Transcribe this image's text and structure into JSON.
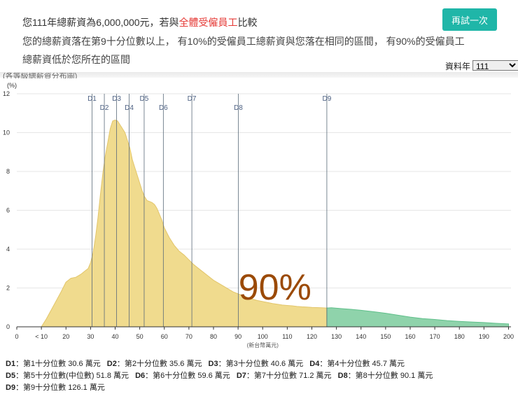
{
  "header": {
    "line1_prefix": "您111年總薪資為6,000,000元，若與",
    "line1_highlight": "全體受僱員工",
    "line1_suffix": "比較",
    "line2": "您的總薪資落在第9十分位數以上， 有10%的受僱員工總薪資與您落在相同的區間， 有90%的受僱員工",
    "line3": "總薪資低於您所在的區間",
    "retry_label": "再試一次",
    "year_label": "資料年",
    "year_value": "111",
    "cutoff_text": "(各等級總薪資分布圖)"
  },
  "chart_data": {
    "type": "area",
    "ylabel": "(%)",
    "xlabel": "(新台幣萬元)",
    "xlim": [
      0,
      201
    ],
    "ylim": [
      0,
      12
    ],
    "x_ticks": [
      0,
      10,
      20,
      30,
      40,
      50,
      60,
      70,
      80,
      90,
      100,
      110,
      120,
      130,
      140,
      150,
      160,
      170,
      180,
      190,
      200
    ],
    "x_tick_labels": [
      "0",
      "< 10",
      "20",
      "30",
      "40",
      "50",
      "60",
      "70",
      "80",
      "90",
      "100",
      "110",
      "120",
      "130",
      "140",
      "150",
      "160",
      "170",
      "180",
      "190",
      "200"
    ],
    "y_ticks": [
      0,
      2,
      4,
      6,
      8,
      10,
      12
    ],
    "colors": {
      "below": "#f0db8e",
      "below_stroke": "#e2c56a",
      "above": "#8fd3ab",
      "above_stroke": "#5fbf8a",
      "decile_line": "#5a6a7a",
      "decile_label": "#4a5e80",
      "percent_text": "#9b4a06"
    },
    "series": [
      {
        "x": [
          10,
          12,
          15,
          18,
          20,
          22,
          24,
          26,
          28,
          29,
          30,
          31,
          32,
          33,
          34,
          35,
          36,
          37,
          38,
          39,
          40,
          41,
          42,
          43,
          44,
          45,
          46,
          47,
          48,
          49,
          50,
          51,
          52,
          53,
          54,
          55,
          56,
          57,
          58,
          59,
          60,
          62,
          64,
          66,
          68,
          70,
          72,
          74,
          76,
          78,
          80,
          82,
          84,
          86,
          88,
          90,
          92,
          94,
          96,
          98,
          100,
          102,
          104,
          106,
          108,
          110,
          112,
          114,
          116,
          118,
          120,
          122,
          124,
          126,
          128,
          130,
          133,
          136,
          140,
          145,
          150,
          155,
          160,
          165,
          170,
          175,
          180,
          185,
          190,
          195,
          200
        ],
        "values": [
          0,
          0.4,
          1.1,
          1.8,
          2.3,
          2.5,
          2.55,
          2.7,
          2.9,
          3.0,
          3.3,
          3.8,
          4.6,
          5.6,
          6.8,
          7.9,
          8.8,
          9.5,
          10.2,
          10.6,
          10.65,
          10.6,
          10.4,
          10.2,
          10.0,
          9.6,
          9.2,
          8.6,
          8.2,
          7.8,
          7.4,
          7.0,
          6.7,
          6.5,
          6.45,
          6.4,
          6.3,
          6.1,
          5.8,
          5.5,
          5.1,
          4.6,
          4.2,
          3.9,
          3.7,
          3.45,
          3.2,
          3.0,
          2.8,
          2.6,
          2.4,
          2.25,
          2.1,
          1.95,
          1.8,
          1.7,
          1.6,
          1.5,
          1.42,
          1.35,
          1.3,
          1.25,
          1.2,
          1.16,
          1.12,
          1.1,
          1.08,
          1.05,
          1.03,
          1.02,
          1.0,
          0.99,
          0.98,
          0.97,
          0.98,
          0.96,
          0.93,
          0.9,
          0.85,
          0.78,
          0.7,
          0.6,
          0.5,
          0.42,
          0.38,
          0.32,
          0.28,
          0.25,
          0.22,
          0.18,
          0.15
        ]
      }
    ],
    "split_x": 126.1,
    "percent_label": "90%",
    "percent_label_x": 105,
    "percent_label_y": 1.4,
    "deciles": [
      {
        "name": "D1",
        "value": 30.6
      },
      {
        "name": "D2",
        "value": 35.6
      },
      {
        "name": "D3",
        "value": 40.6
      },
      {
        "name": "D4",
        "value": 45.7
      },
      {
        "name": "D5",
        "value": 51.8
      },
      {
        "name": "D6",
        "value": 59.6
      },
      {
        "name": "D7",
        "value": 71.2
      },
      {
        "name": "D8",
        "value": 90.1
      },
      {
        "name": "D9",
        "value": 126.1
      }
    ]
  },
  "legend": [
    {
      "key": "D1",
      "text": "第1十分位數 30.6 萬元"
    },
    {
      "key": "D2",
      "text": "第2十分位數 35.6 萬元"
    },
    {
      "key": "D3",
      "text": "第3十分位數 40.6 萬元"
    },
    {
      "key": "D4",
      "text": "第4十分位數 45.7 萬元"
    },
    {
      "key": "D5",
      "text": "第5十分位數(中位數) 51.8 萬元"
    },
    {
      "key": "D6",
      "text": "第6十分位數 59.6 萬元"
    },
    {
      "key": "D7",
      "text": "第7十分位數 71.2 萬元"
    },
    {
      "key": "D8",
      "text": "第8十分位數 90.1 萬元"
    },
    {
      "key": "D9",
      "text": "第9十分位數 126.1 萬元"
    }
  ]
}
